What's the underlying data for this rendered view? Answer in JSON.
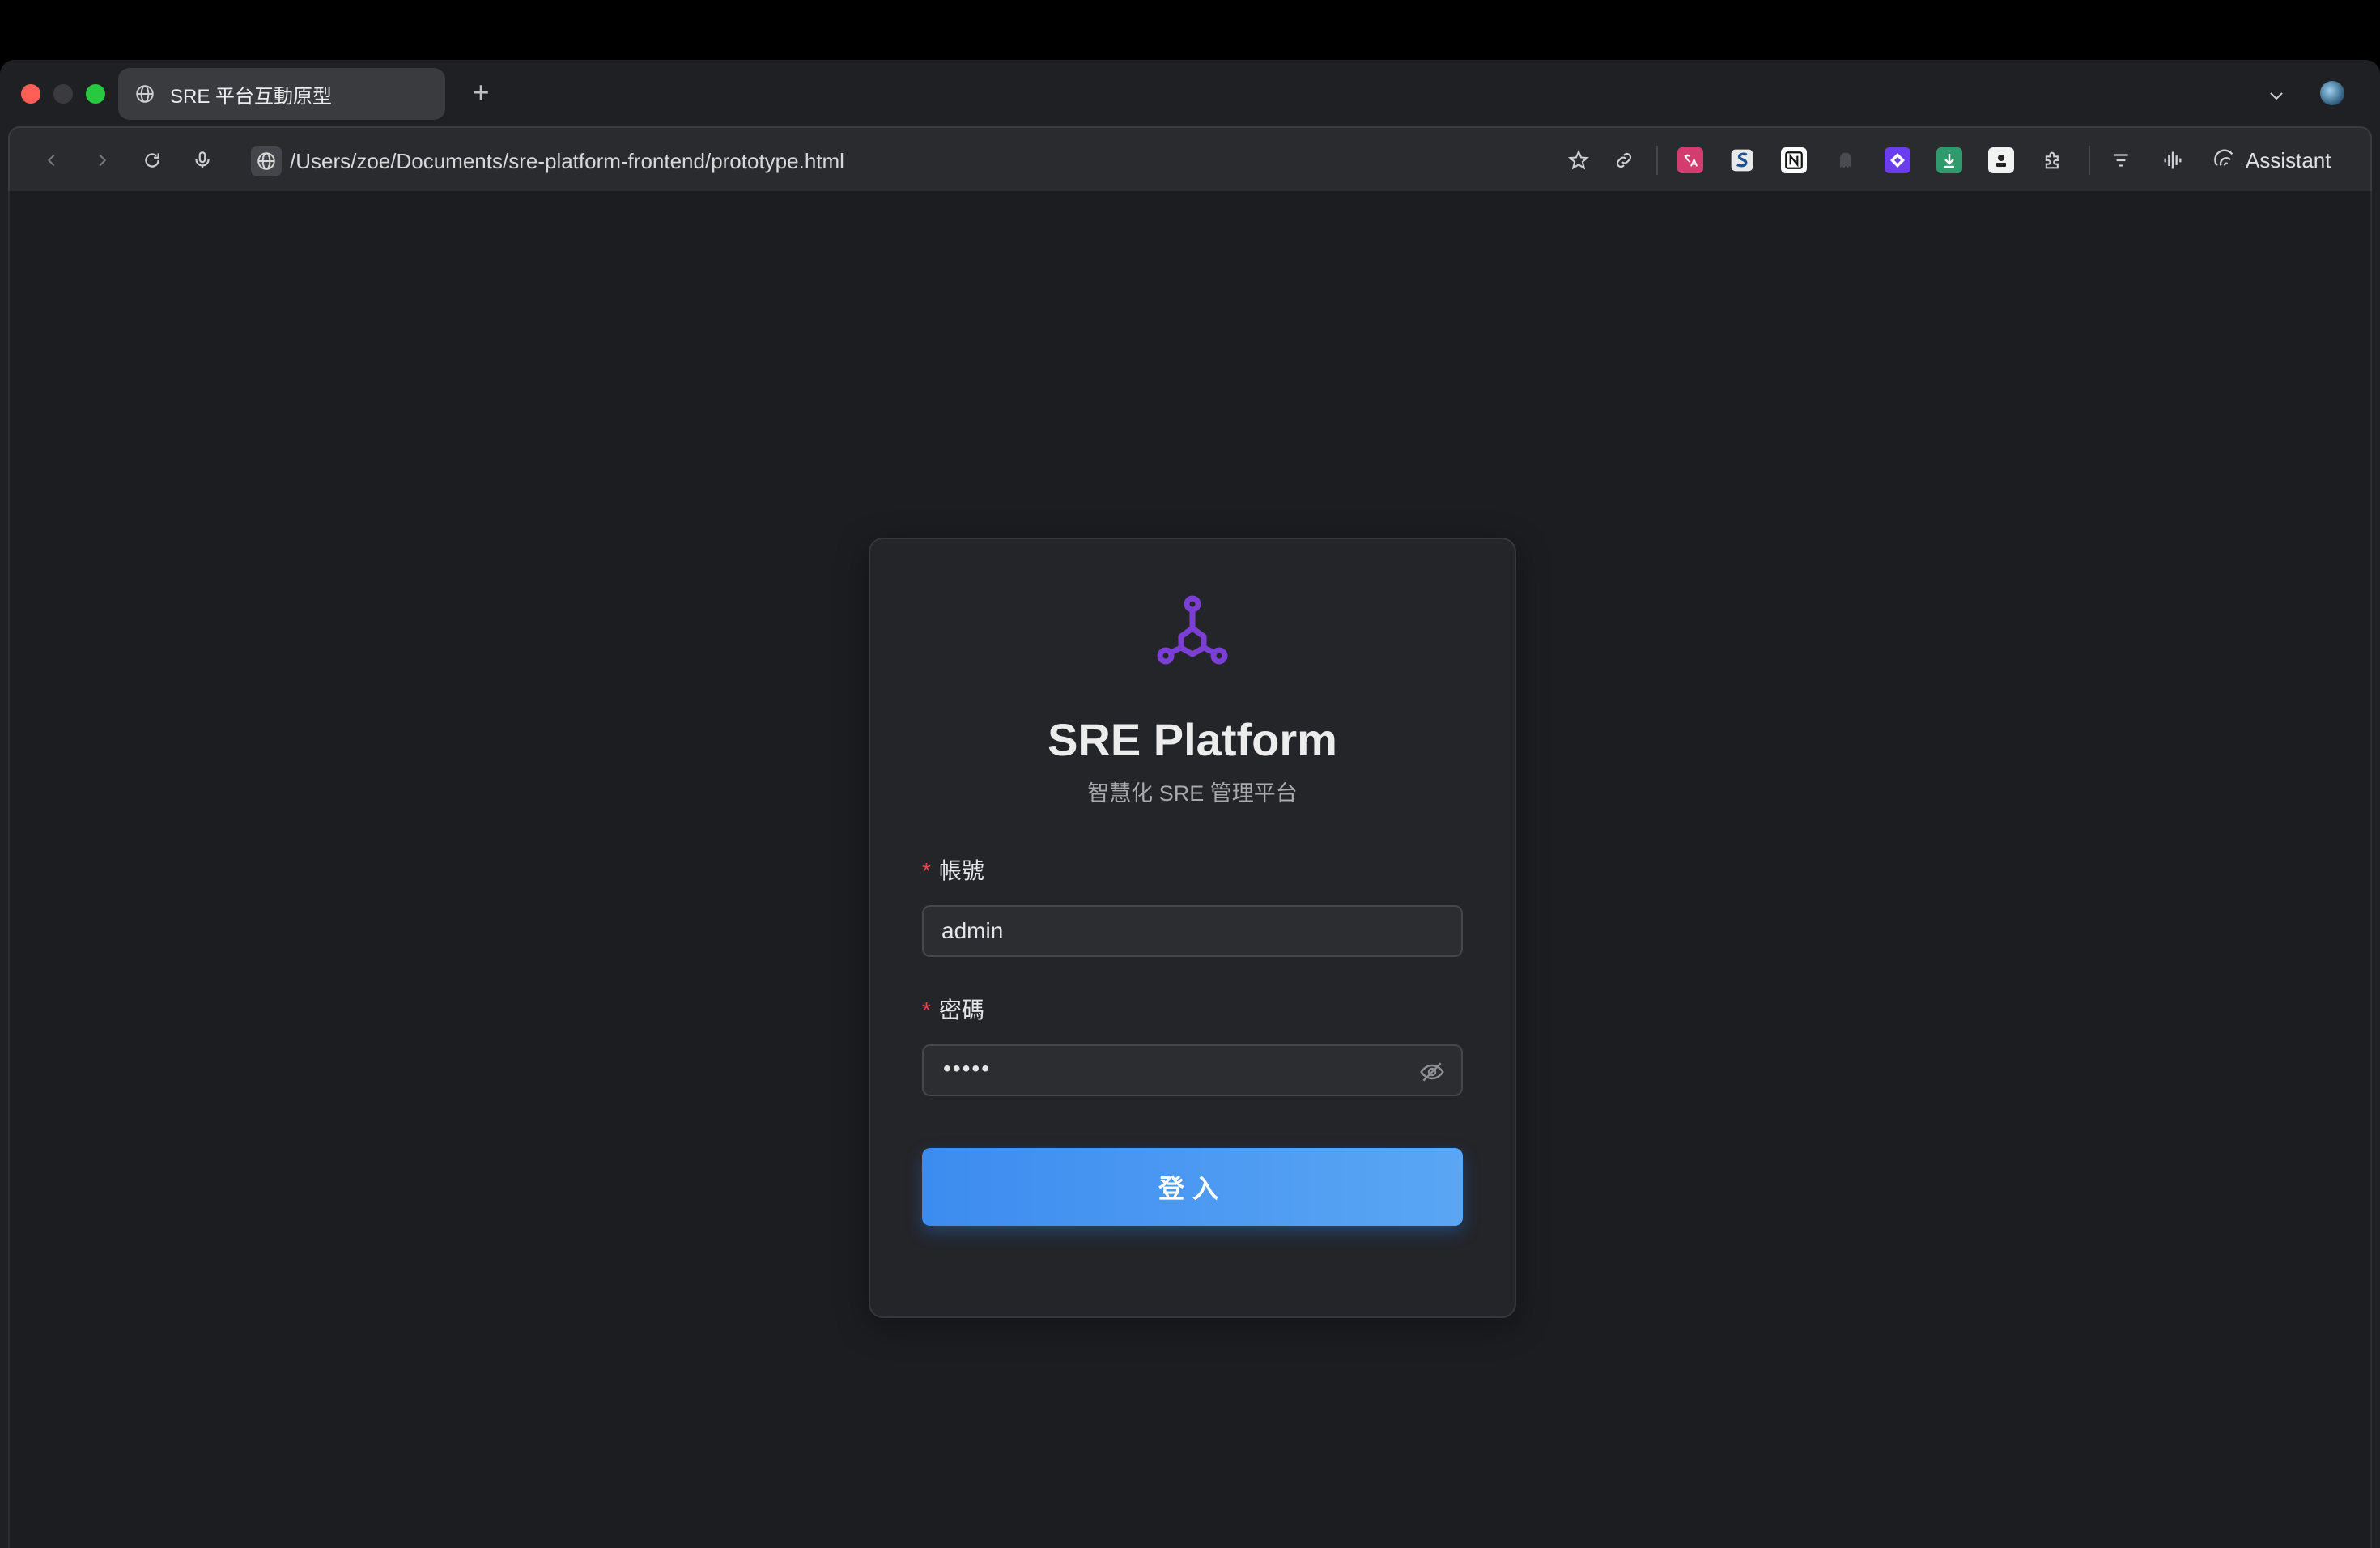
{
  "browser": {
    "tab_title": "SRE 平台互動原型",
    "new_tab_symbol": "+",
    "address": "/Users/zoe/Documents/sre-platform-frontend/prototype.html",
    "assistant_label": "Assistant",
    "extensions": [
      "translate-ext",
      "s-ext",
      "notion-ext",
      "ghost-ext",
      "diamond-ext",
      "download-ext",
      "id-ext",
      "puzzle-ext"
    ]
  },
  "login": {
    "title": "SRE Platform",
    "subtitle": "智慧化 SRE 管理平台",
    "required_mark": "*",
    "username_label": "帳號",
    "username_value": "admin",
    "password_label": "密碼",
    "password_masked": "•••••",
    "submit_label": "登入"
  },
  "colors": {
    "accent": "#7b3fd6",
    "button": "#4a97f2",
    "required": "#e5484d",
    "page_bg": "#1c1d20",
    "card_bg": "#242529"
  }
}
